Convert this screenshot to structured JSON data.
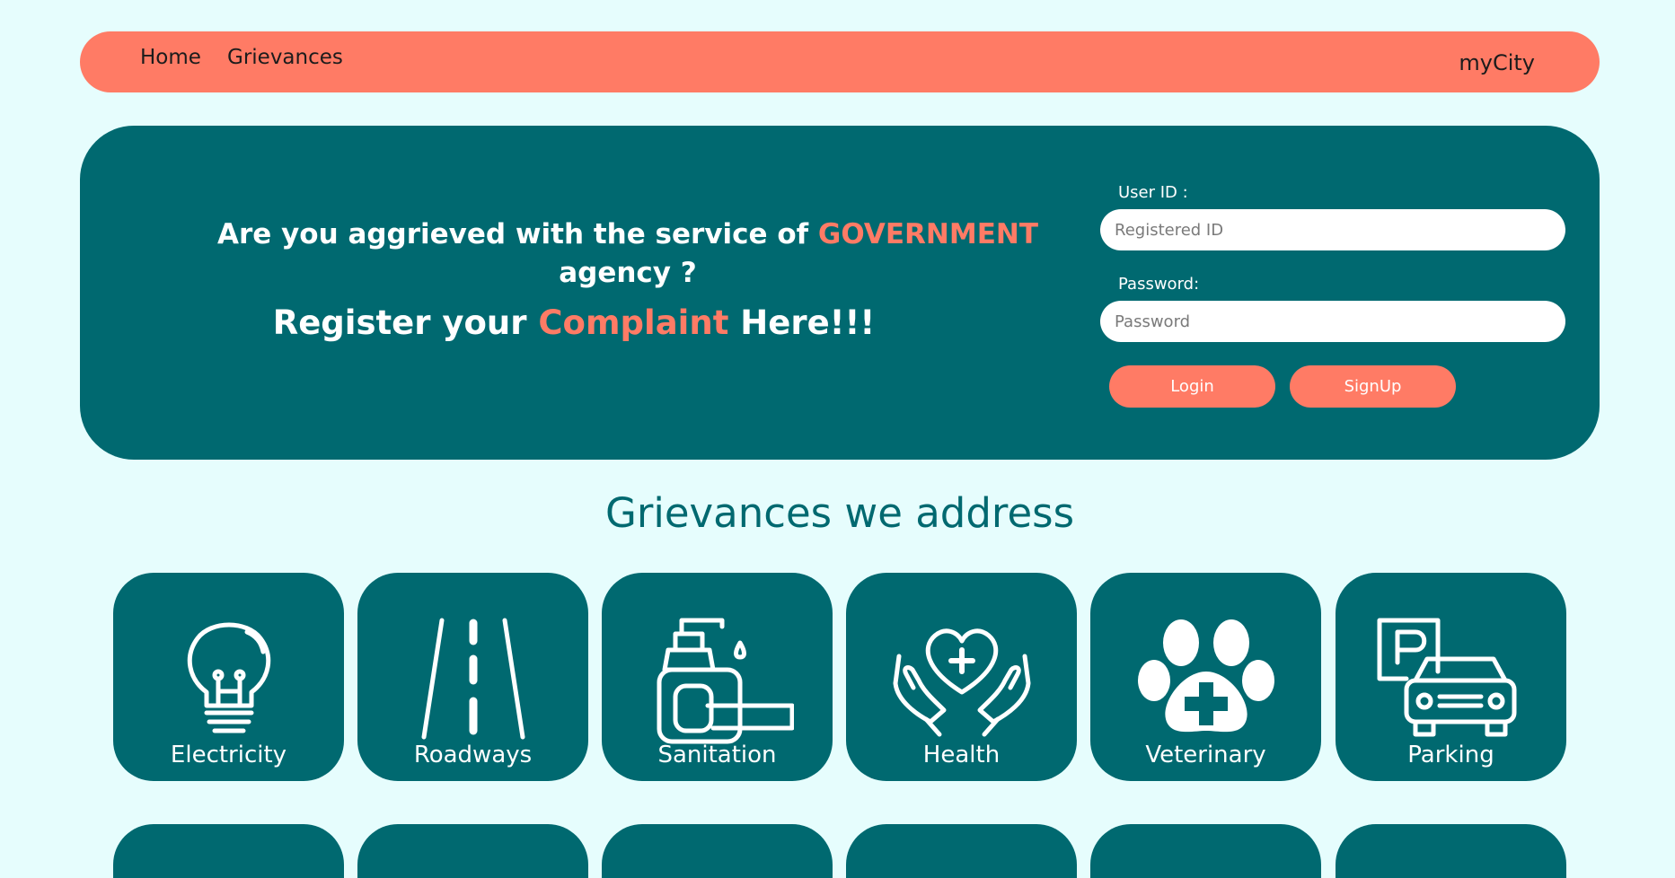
{
  "nav": {
    "home": "Home",
    "grievances": "Grievances",
    "brand": "myCity"
  },
  "hero": {
    "line1_prefix": "Are you aggrieved with the service of ",
    "line1_accent": "GOVERNMENT",
    "line1_suffix": " agency ?",
    "line2_prefix": "Register your ",
    "line2_accent": "Complaint",
    "line2_suffix": " Here!!!"
  },
  "login": {
    "user_label": "User ID :",
    "user_placeholder": "Registered ID",
    "password_label": "Password:",
    "password_placeholder": "Password",
    "login_button": "Login",
    "signup_button": "SignUp"
  },
  "section": {
    "title": "Grievances we address"
  },
  "categories": [
    {
      "label": "Electricity",
      "icon": "lightbulb-icon"
    },
    {
      "label": "Roadways",
      "icon": "road-icon"
    },
    {
      "label": "Sanitation",
      "icon": "soap-dispenser-icon"
    },
    {
      "label": "Health",
      "icon": "hands-heart-icon"
    },
    {
      "label": "Veterinary",
      "icon": "paw-cross-icon"
    },
    {
      "label": "Parking",
      "icon": "parking-car-icon"
    }
  ],
  "colors": {
    "background": "#e6fdfd",
    "primary": "#006970",
    "accent": "#ff7b65",
    "white": "#ffffff"
  }
}
